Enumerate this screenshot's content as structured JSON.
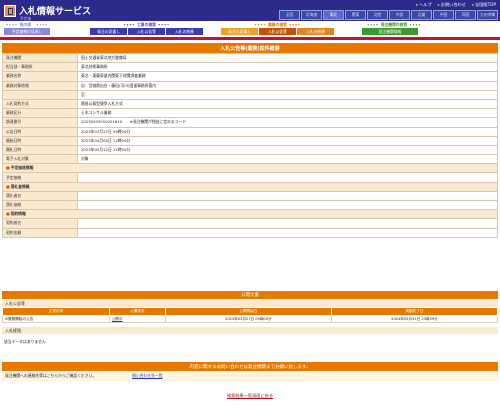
{
  "header": {
    "title": "入札情報サービス",
    "links": [
      "ヘルプ",
      "お問い合わせ",
      "全国版TOP"
    ],
    "regions": [
      "全国",
      "北海道",
      "東北",
      "関東",
      "北陸",
      "中部",
      "近畿",
      "中国",
      "四国",
      "九州沖縄"
    ],
    "active_region": "東北"
  },
  "nav": {
    "groups": [
      {
        "title": "予定価格の検索",
        "color": "#8a8ad8",
        "buttons": [
          {
            "label": "予定価格の見直し",
            "bg": "#8a8ad8"
          }
        ]
      },
      {
        "title": "工事の検索",
        "color": "#4a4ac0",
        "buttons": [
          {
            "label": "発注の見通し",
            "bg": "#3b3bb0"
          },
          {
            "label": "入札公告等",
            "bg": "#3b3bb0"
          },
          {
            "label": "入札の結果",
            "bg": "#3b3bb0"
          }
        ]
      },
      {
        "title": "業務の検索",
        "color": "#e07000",
        "buttons": [
          {
            "label": "発注の見通し",
            "bg": "#f0a020"
          },
          {
            "label": "入札公告等",
            "bg": "#c85000"
          },
          {
            "label": "入札の結果",
            "bg": "#e88020"
          }
        ]
      },
      {
        "title": "発注機関の検索",
        "color": "#3a9a30",
        "buttons": [
          {
            "label": "発注機関情報",
            "bg": "#3a9a30"
          }
        ]
      }
    ]
  },
  "page_title": "入札公告等(業務)案件概要",
  "details": [
    {
      "type": "row",
      "label": "発注機関",
      "value": "国土交通省東北地方整備局"
    },
    {
      "type": "row",
      "label": "担当部・事務所",
      "value": "東北技術事務所"
    },
    {
      "type": "row",
      "label": "業務名称",
      "value": "東北・東藤東道内関東下技関調査業務"
    },
    {
      "type": "row",
      "label": "業務対象地域",
      "value": "自：宮城県仙台・藤田(河川)国道事務所管内"
    },
    {
      "type": "row",
      "label": "",
      "value": "至："
    },
    {
      "type": "row",
      "label": "入札契約方式",
      "value": "簡易公募型競争入札方式"
    },
    {
      "type": "row",
      "label": "業務区分",
      "value": "土木コンサル業務"
    },
    {
      "type": "row",
      "label": "調達番号",
      "value": "20230203010201610　　※発注機関が独自に定めるコード"
    },
    {
      "type": "row",
      "label": "公告日時",
      "value": "2023年03月27日 09時00分"
    },
    {
      "type": "row",
      "label": "開始日時",
      "value": "2023年04月05日 12時00分"
    },
    {
      "type": "row",
      "label": "開札日時",
      "value": "2023年05月12日 11時00分"
    },
    {
      "type": "row",
      "label": "電子入札対象",
      "value": "対象"
    },
    {
      "type": "sec",
      "label": "予定価格情報"
    },
    {
      "type": "row",
      "label": "予定価格",
      "value": ""
    },
    {
      "type": "sec",
      "label": "落札者情報"
    },
    {
      "type": "row",
      "label": "落札者名",
      "value": ""
    },
    {
      "type": "row",
      "label": "落札価格",
      "value": ""
    },
    {
      "type": "sec",
      "label": "契約情報"
    },
    {
      "type": "row",
      "label": "契約者名",
      "value": ""
    },
    {
      "type": "row",
      "label": "契約金額",
      "value": ""
    }
  ],
  "public_docs": {
    "header": "公開文書",
    "notice_section": "入札公告等",
    "columns": [
      "文書名称",
      "公開状況",
      "公開開始日",
      "掲載終了日"
    ],
    "rows": [
      [
        "※業務開始の公告",
        "公開中",
        "2023年03月27日 09時00分",
        "2024年05月31日 23時59分"
      ]
    ],
    "result_section": "入札経過",
    "no_data": "該当データはありません"
  },
  "contact": {
    "header": "内容に関するお問い合わせは発注機関までお願い致します。",
    "text": "発注機関への連絡先等はこちらからご確認ください。",
    "link": "問い合わせ先一覧"
  },
  "back_link": "検索結果一覧画面に戻る"
}
